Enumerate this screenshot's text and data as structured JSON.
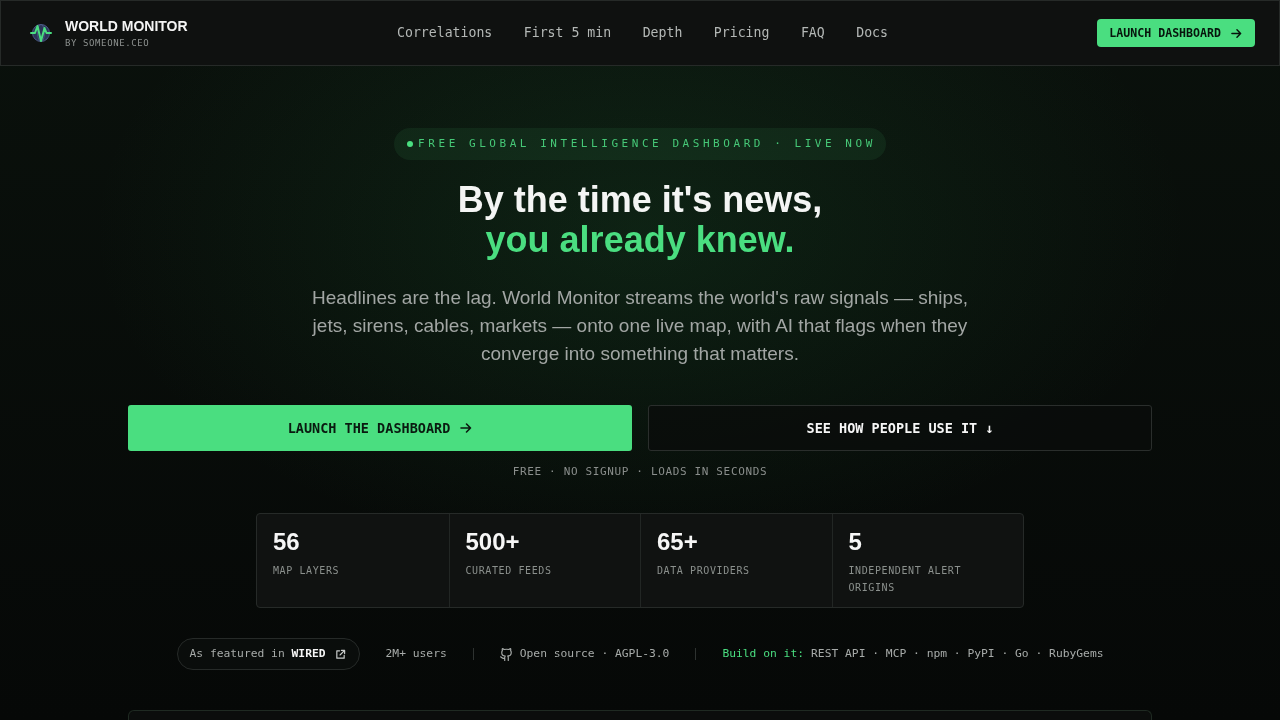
{
  "header": {
    "brand": {
      "name": "WORLD MONITOR",
      "tagline": "BY SOMEONE.CEO"
    },
    "nav": [
      "Correlations",
      "First 5 min",
      "Depth",
      "Pricing",
      "FAQ",
      "Docs"
    ],
    "cta": "LAUNCH DASHBOARD"
  },
  "hero": {
    "badge": "FREE GLOBAL INTELLIGENCE DASHBOARD · LIVE NOW",
    "headline": [
      {
        "text": "By the time it's news,",
        "highlight": false
      },
      {
        "text": "you already knew.",
        "highlight": true
      }
    ],
    "description": "Headlines are the lag. World Monitor streams the world's raw signals — ships, jets, sirens, cables, markets — onto one live map, with AI that flags when they converge into something that matters.",
    "actions": [
      {
        "kind": "primary",
        "label": "LAUNCH THE DASHBOARD"
      },
      {
        "kind": "secondary",
        "label": "SEE HOW PEOPLE USE IT ↓"
      }
    ],
    "note": "FREE · NO SIGNUP · LOADS IN SECONDS"
  },
  "stats": [
    {
      "value": "56",
      "label": "MAP LAYERS"
    },
    {
      "value": "500+",
      "label": "CURATED FEEDS"
    },
    {
      "value": "65+",
      "label": "DATA PROVIDERS"
    },
    {
      "value": "5",
      "label": "INDEPENDENT ALERT ORIGINS"
    }
  ],
  "proof": {
    "featured": "As featured in **WIRED**",
    "users": "2M+ users",
    "open_source": "Open source · AGPL-3.0",
    "build": {
      "label": "Build on it:",
      "targets": "REST API · MCP · npm · PyPI · Go · RubyGems"
    }
  }
}
